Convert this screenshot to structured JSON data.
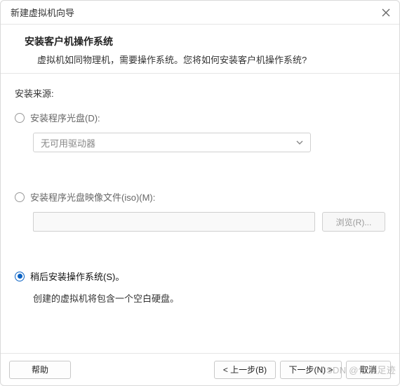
{
  "window": {
    "title": "新建虚拟机向导"
  },
  "header": {
    "title": "安装客户机操作系统",
    "subtitle": "虚拟机如同物理机，需要操作系统。您将如何安装客户机操作系统?"
  },
  "source": {
    "label": "安装来源:",
    "opt_disc": {
      "label": "安装程序光盘(D):",
      "drive_placeholder": "无可用驱动器"
    },
    "opt_iso": {
      "label": "安装程序光盘映像文件(iso)(M):",
      "browse": "浏览(R)..."
    },
    "opt_later": {
      "label": "稍后安装操作系统(S)。",
      "desc": "创建的虚拟机将包含一个空白硬盘。"
    }
  },
  "footer": {
    "help": "帮助",
    "back": "< 上一步(B)",
    "next": "下一步(N) >",
    "cancel": "取消"
  },
  "watermark": "CSDN @亿燃足迹"
}
